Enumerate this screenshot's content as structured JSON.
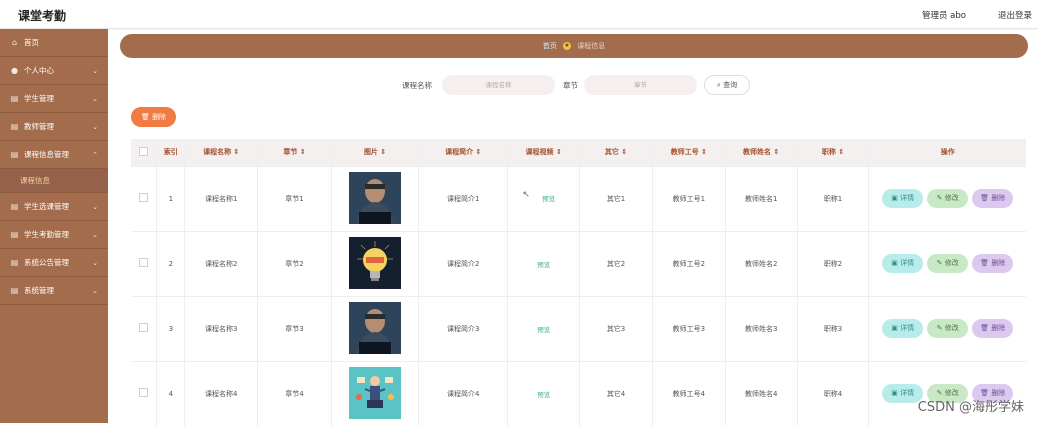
{
  "header": {
    "app_title": "课堂考勤",
    "admin_label": "管理员 abo",
    "logout_label": "退出登录"
  },
  "sidebar": {
    "items": [
      {
        "label": "首页",
        "icon": "home-icon"
      },
      {
        "label": "个人中心",
        "icon": "user-icon"
      },
      {
        "label": "学生管理",
        "icon": "list-icon"
      },
      {
        "label": "教师管理",
        "icon": "list-icon"
      },
      {
        "label": "课程信息管理",
        "icon": "list-icon"
      },
      {
        "label": "课程信息",
        "sub": true
      },
      {
        "label": "学生选课管理",
        "icon": "list-icon"
      },
      {
        "label": "学生考勤管理",
        "icon": "list-icon"
      },
      {
        "label": "系统公告管理",
        "icon": "list-icon"
      },
      {
        "label": "系统管理",
        "icon": "list-icon"
      }
    ]
  },
  "breadcrumb": {
    "home": "首页",
    "current": "课程信息"
  },
  "search": {
    "course_label": "课程名称",
    "course_placeholder": "课程名称",
    "chapter_label": "章节",
    "chapter_placeholder": "章节",
    "button_label": "查询"
  },
  "toolbar": {
    "delete_label": "删除"
  },
  "table": {
    "columns": [
      "索引",
      "课程名称",
      "章节",
      "图片",
      "课程简介",
      "课程视频",
      "其它",
      "教师工号",
      "教师姓名",
      "职称",
      "操作"
    ],
    "rows": [
      {
        "index": "1",
        "name": "课程名称1",
        "chapter": "章节1",
        "intro": "课程简介1",
        "video": "预览",
        "other": "其它1",
        "teacher_id": "教师工号1",
        "teacher_name": "教师姓名1",
        "title": "职称1",
        "image": "man-laptop"
      },
      {
        "index": "2",
        "name": "课程名称2",
        "chapter": "章节2",
        "intro": "课程简介2",
        "video": "预览",
        "other": "其它2",
        "teacher_id": "教师工号2",
        "teacher_name": "教师姓名2",
        "title": "职称2",
        "image": "lightbulb"
      },
      {
        "index": "3",
        "name": "课程名称3",
        "chapter": "章节3",
        "intro": "课程简介3",
        "video": "预览",
        "other": "其它3",
        "teacher_id": "教师工号3",
        "teacher_name": "教师姓名3",
        "title": "职称3",
        "image": "man-laptop"
      },
      {
        "index": "4",
        "name": "课程名称4",
        "chapter": "章节4",
        "intro": "课程简介4",
        "video": "预览",
        "other": "其它4",
        "teacher_id": "教师工号4",
        "teacher_name": "教师姓名4",
        "title": "职称4",
        "image": "multitask-figure"
      }
    ],
    "actions": {
      "detail": "详情",
      "edit": "修改",
      "delete": "删除"
    }
  },
  "watermark": "CSDN @海彤学妹",
  "colors": {
    "sidebar": "#A36C4C",
    "accent_orange": "#F07B43",
    "header_text": "#A34F2E"
  }
}
